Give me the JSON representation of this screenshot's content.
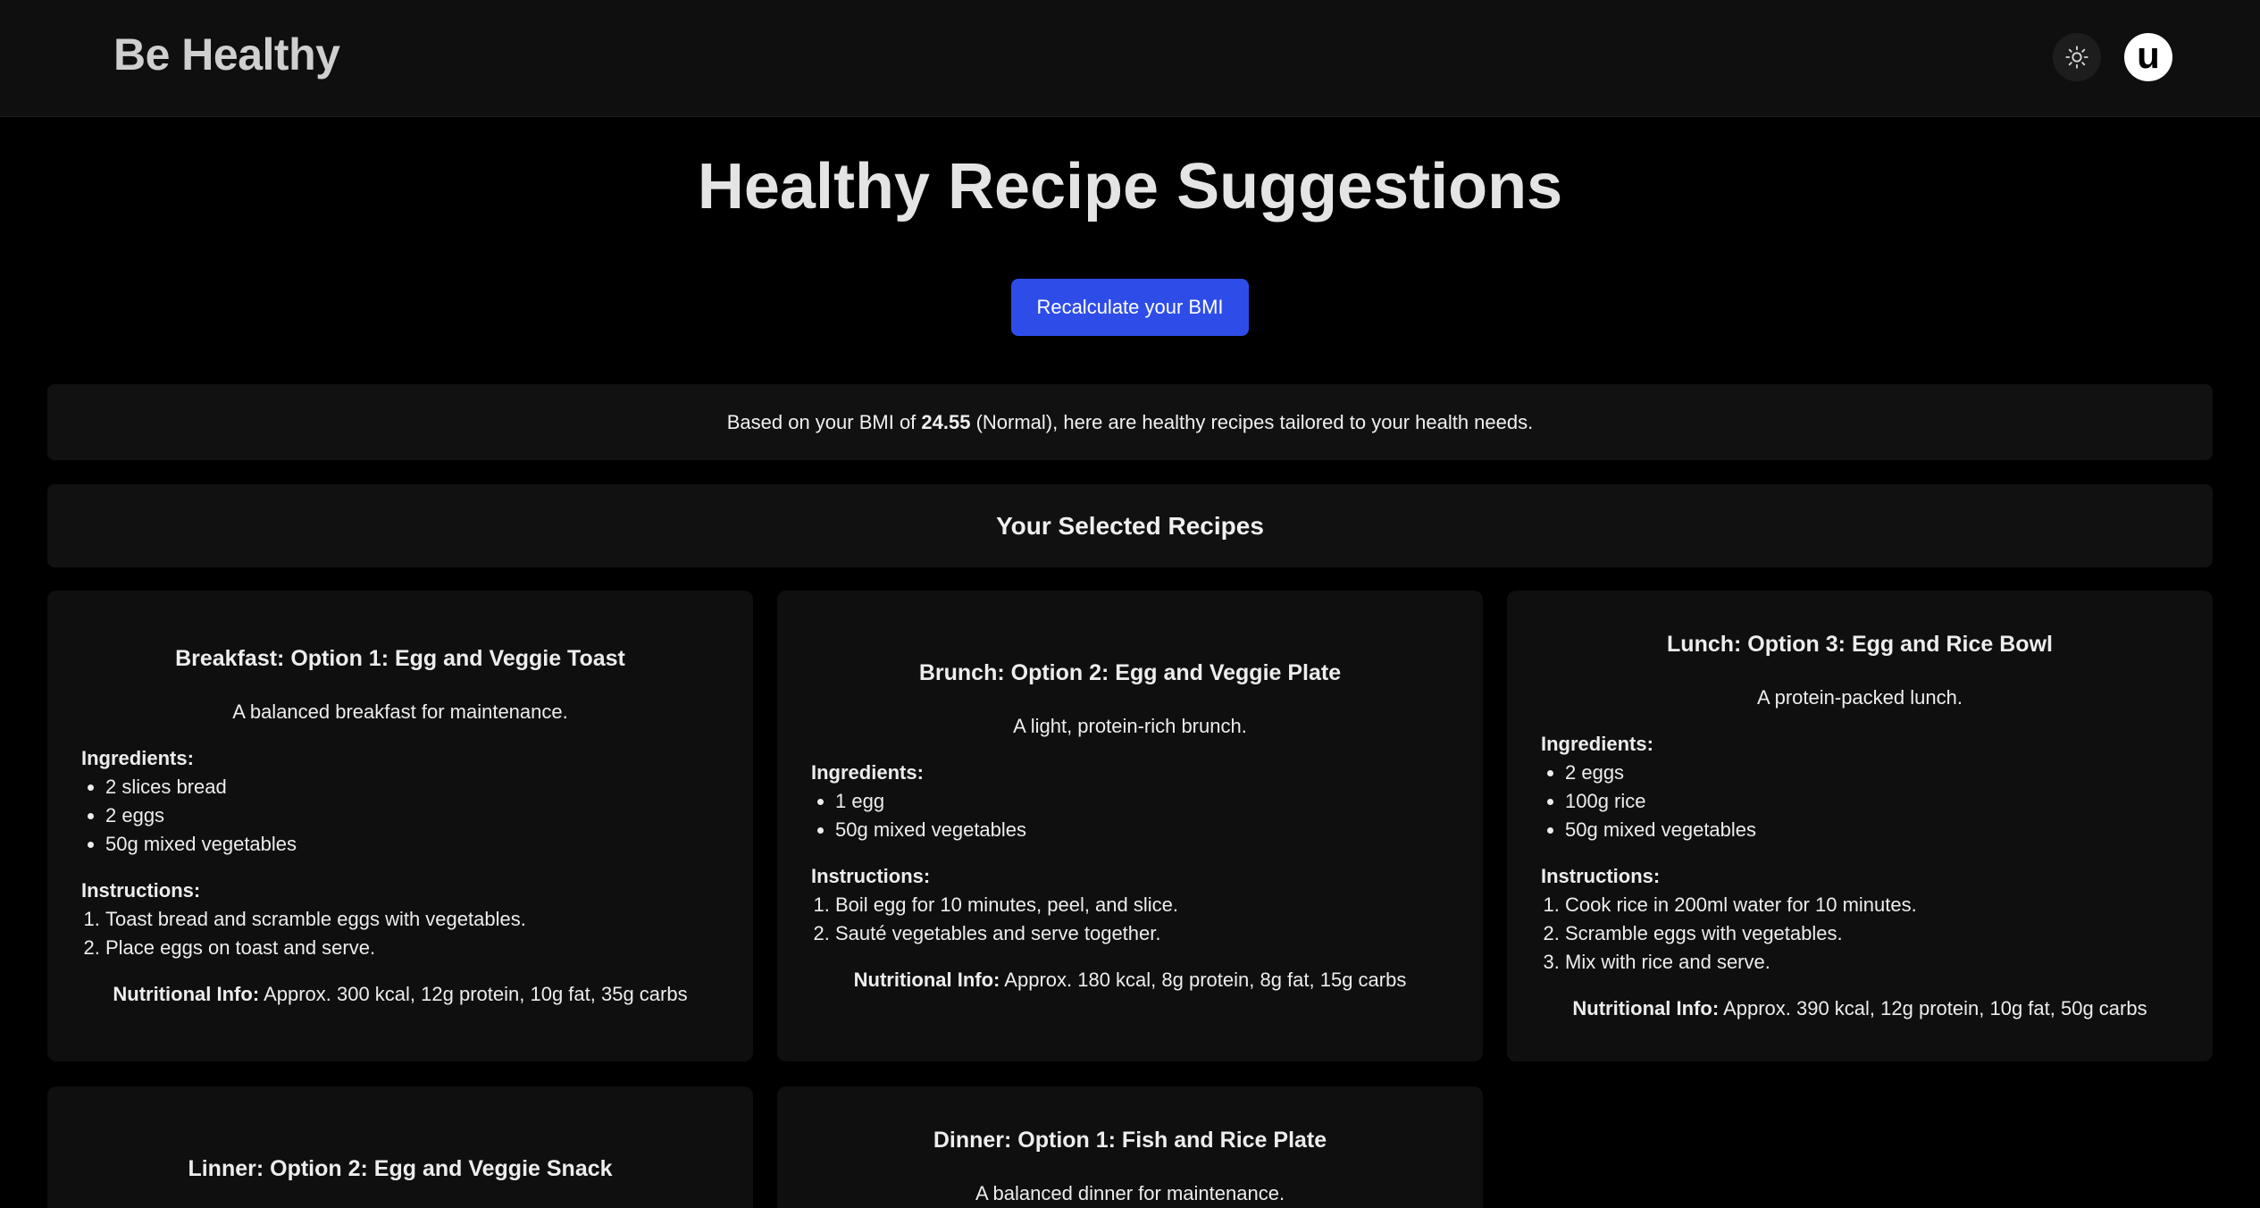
{
  "header": {
    "brand": "Be Healthy",
    "avatar_letter": "u"
  },
  "main": {
    "title": "Healthy Recipe Suggestions",
    "recalc_label": "Recalculate your BMI",
    "bmi_prefix": "Based on your BMI of ",
    "bmi_value": "24.55",
    "bmi_suffix": " (Normal), here are healthy recipes tailored to your health needs.",
    "selected_heading": "Your Selected Recipes"
  },
  "labels": {
    "ingredients": "Ingredients:",
    "instructions": "Instructions:",
    "nutrition": "Nutritional Info:"
  },
  "recipes": [
    {
      "title": "Breakfast: Option 1: Egg and Veggie Toast",
      "description": "A balanced breakfast for maintenance.",
      "ingredients": [
        "2 slices bread",
        "2 eggs",
        "50g mixed vegetables"
      ],
      "instructions": [
        "Toast bread and scramble eggs with vegetables.",
        "Place eggs on toast and serve."
      ],
      "nutrition": "Approx. 300 kcal, 12g protein, 10g fat, 35g carbs"
    },
    {
      "title": "Brunch: Option 2: Egg and Veggie Plate",
      "description": "A light, protein-rich brunch.",
      "ingredients": [
        "1 egg",
        "50g mixed vegetables"
      ],
      "instructions": [
        "Boil egg for 10 minutes, peel, and slice.",
        "Sauté vegetables and serve together."
      ],
      "nutrition": "Approx. 180 kcal, 8g protein, 8g fat, 15g carbs"
    },
    {
      "title": "Lunch: Option 3: Egg and Rice Bowl",
      "description": "A protein-packed lunch.",
      "ingredients": [
        "2 eggs",
        "100g rice",
        "50g mixed vegetables"
      ],
      "instructions": [
        "Cook rice in 200ml water for 10 minutes.",
        "Scramble eggs with vegetables.",
        "Mix with rice and serve."
      ],
      "nutrition": "Approx. 390 kcal, 12g protein, 10g fat, 50g carbs"
    },
    {
      "title": "Linner: Option 2: Egg and Veggie Snack"
    },
    {
      "title": "Dinner: Option 1: Fish and Rice Plate",
      "description": "A balanced dinner for maintenance."
    }
  ],
  "colors": {
    "accent": "#2e4de8",
    "background": "#000000",
    "panel": "#111111"
  }
}
